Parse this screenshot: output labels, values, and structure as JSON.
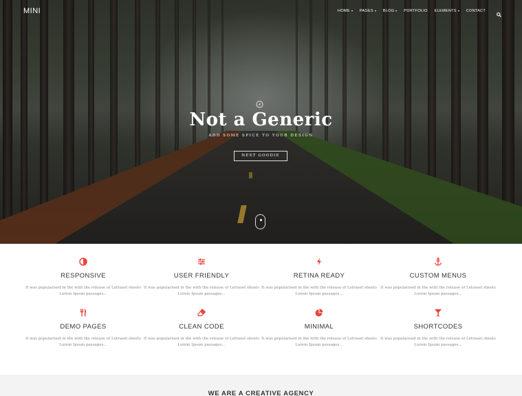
{
  "header": {
    "logo": "MINI",
    "nav": [
      {
        "label": "HOME",
        "has_dropdown": true
      },
      {
        "label": "PAGES",
        "has_dropdown": true
      },
      {
        "label": "BLOG",
        "has_dropdown": true
      },
      {
        "label": "PORTFOLIO",
        "has_dropdown": false
      },
      {
        "label": "ELEMENTS",
        "has_dropdown": true
      },
      {
        "label": "CONTACT",
        "has_dropdown": false
      }
    ],
    "search_icon": "search-icon"
  },
  "hero": {
    "icon": "compass-icon",
    "title": "Not a Generic",
    "subtitle": "ADD SOME SPICE TO YOUR DESIGN",
    "button_label": "NEXT GOODIE",
    "scroll_icon": "mouse-scroll-icon"
  },
  "features": {
    "accent_color": "#e8463c",
    "items": [
      {
        "icon": "contrast-icon",
        "title": "RESPONSIVE",
        "text": "It was popularised in the with the release of Letraset sheets Lorem Ipsum passages..."
      },
      {
        "icon": "sliders-icon",
        "title": "USER FRIENDLY",
        "text": "It was popularised in the with the release of Letraset sheets Lorem Ipsum passages..."
      },
      {
        "icon": "bolt-icon",
        "title": "RETINA READY",
        "text": "It was popularised in the with the release of Letraset sheets Lorem Ipsum passages..."
      },
      {
        "icon": "anchor-icon",
        "title": "CUSTOM MENUS",
        "text": "It was popularised in the with the release of Letraset sheets Lorem Ipsum passages..."
      },
      {
        "icon": "cutlery-icon",
        "title": "DEMO PAGES",
        "text": "It was popularised in the with the release of Letraset sheets Lorem Ipsum passages..."
      },
      {
        "icon": "eraser-icon",
        "title": "CLEAN CODE",
        "text": "It was popularised in the with the release of Letraset sheets Lorem Ipsum passages..."
      },
      {
        "icon": "pie-chart-icon",
        "title": "MINIMAL",
        "text": "It was popularised in the with the release of Letraset sheets Lorem Ipsum passages..."
      },
      {
        "icon": "cocktail-icon",
        "title": "SHORTCODES",
        "text": "It was popularised in the with the release of Letraset sheets Lorem Ipsum passages..."
      }
    ]
  },
  "agency": {
    "title": "WE ARE A CREATIVE AGENCY"
  }
}
